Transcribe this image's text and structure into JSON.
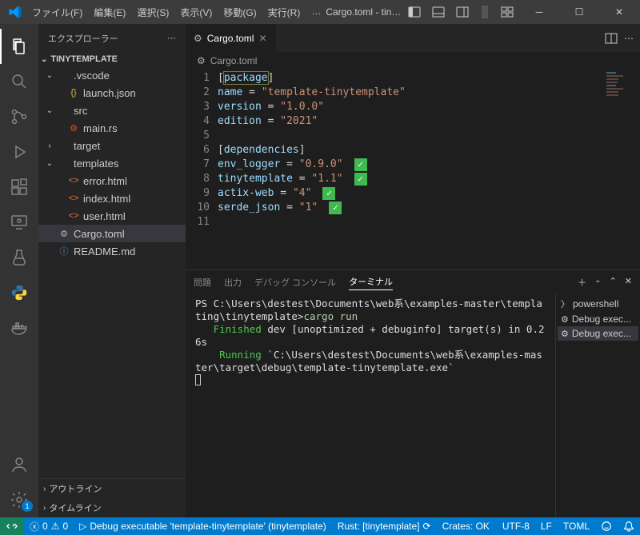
{
  "titlebar": {
    "menus": [
      "ファイル(F)",
      "編集(E)",
      "選択(S)",
      "表示(V)",
      "移動(G)",
      "実行(R)",
      "…"
    ],
    "title": "Cargo.toml - tinytemplate - Visual ..."
  },
  "sidebar": {
    "header": "エクスプローラー",
    "project": "TINYTEMPLATE",
    "tree": [
      {
        "type": "folder",
        "open": true,
        "name": ".vscode",
        "depth": 0
      },
      {
        "type": "file",
        "name": "launch.json",
        "depth": 1,
        "icon": "{}",
        "iconColor": "#d9b74a"
      },
      {
        "type": "folder",
        "open": true,
        "name": "src",
        "depth": 0
      },
      {
        "type": "file",
        "name": "main.rs",
        "depth": 1,
        "icon": "⚙",
        "iconColor": "#f74c00"
      },
      {
        "type": "folder",
        "open": false,
        "name": "target",
        "depth": 0
      },
      {
        "type": "folder",
        "open": true,
        "name": "templates",
        "depth": 0
      },
      {
        "type": "file",
        "name": "error.html",
        "depth": 1,
        "icon": "<>",
        "iconColor": "#e37933"
      },
      {
        "type": "file",
        "name": "index.html",
        "depth": 1,
        "icon": "<>",
        "iconColor": "#e37933"
      },
      {
        "type": "file",
        "name": "user.html",
        "depth": 1,
        "icon": "<>",
        "iconColor": "#e37933"
      },
      {
        "type": "file",
        "name": "Cargo.toml",
        "depth": 0,
        "icon": "⚙",
        "iconColor": "#b1b1b3",
        "selected": true
      },
      {
        "type": "file",
        "name": "README.md",
        "depth": 0,
        "icon": "ⓘ",
        "iconColor": "#519aba"
      }
    ],
    "footer": [
      "アウトライン",
      "タイムライン"
    ]
  },
  "tab": {
    "icon": "⚙",
    "label": "Cargo.toml"
  },
  "breadcrumb": {
    "icon": "⚙",
    "label": "Cargo.toml"
  },
  "code": {
    "lines": [
      {
        "n": 1,
        "html": "<span class='pun'>[</span><span class='kw hl'>package</span><span class='pun'>]</span>"
      },
      {
        "n": 2,
        "html": "<span class='kw'>name</span> <span class='pun'>=</span> <span class='str'>\"template-tinytemplate\"</span>"
      },
      {
        "n": 3,
        "html": "<span class='kw'>version</span> <span class='pun'>=</span> <span class='str'>\"1.0.0\"</span>"
      },
      {
        "n": 4,
        "html": "<span class='kw'>edition</span> <span class='pun'>=</span> <span class='str'>\"2021\"</span>"
      },
      {
        "n": 5,
        "html": ""
      },
      {
        "n": 6,
        "html": "<span class='pun'>[</span><span class='kw'>dependencies</span><span class='pun'>]</span>"
      },
      {
        "n": 7,
        "html": "<span class='kw'>env_logger</span> <span class='pun'>=</span> <span class='str'>\"0.9.0\"</span><span class='check'>✓</span>"
      },
      {
        "n": 8,
        "html": "<span class='kw'>tinytemplate</span> <span class='pun'>=</span> <span class='str'>\"1.1\"</span><span class='check'>✓</span>"
      },
      {
        "n": 9,
        "html": "<span class='kw'>actix-web</span> <span class='pun'>=</span> <span class='str'>\"4\"</span><span class='check'>✓</span>"
      },
      {
        "n": 10,
        "html": "<span class='kw'>serde_json</span> <span class='pun'>=</span> <span class='str'>\"1\"</span><span class='check'>✓</span>"
      },
      {
        "n": 11,
        "html": ""
      }
    ]
  },
  "panel": {
    "tabs": [
      "問題",
      "出力",
      "デバッグ コンソール",
      "ターミナル"
    ],
    "active": 3,
    "terminalLines": [
      "PS C:\\Users\\destest\\Documents\\web系\\examples-master\\templating\\tinytemplate>",
      "cargo run",
      "   Finished",
      " dev [unoptimized + debuginfo] target(s) in 0.26s",
      "    Running",
      " `C:\\Users\\destest\\Documents\\web系\\examples-master\\target\\debug\\template-tinytemplate.exe`"
    ],
    "termList": [
      {
        "icon": "〉",
        "label": "powershell"
      },
      {
        "icon": "⚙",
        "label": "Debug exec..."
      },
      {
        "icon": "⚙",
        "label": "Debug exec...",
        "sel": true
      }
    ]
  },
  "status": {
    "left": {
      "errors": "0",
      "warnings": "0",
      "debug": "Debug executable 'template-tinytemplate' (tinytemplate)",
      "rust": "Rust: [tinytemplate]",
      "crates": "Crates: OK"
    },
    "right": {
      "enc": "UTF-8",
      "eol": "LF",
      "lang": "TOML"
    }
  },
  "settingsBadge": "1"
}
